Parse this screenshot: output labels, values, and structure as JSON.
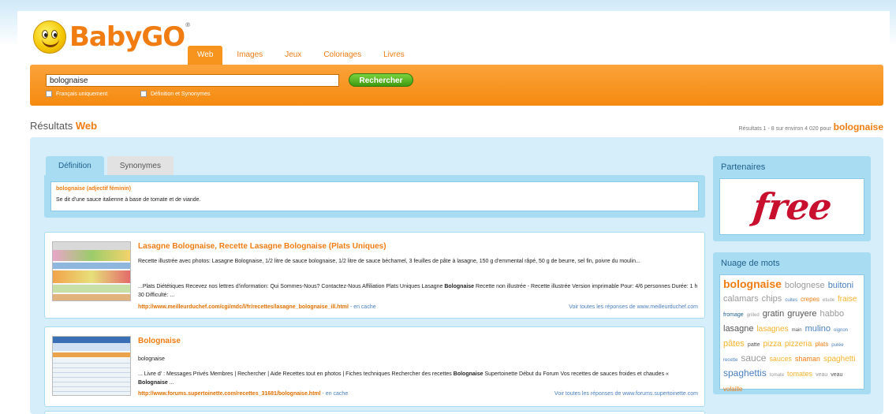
{
  "header": {
    "logo_text": "BabyGO",
    "logo_mark": "®",
    "tabs": [
      {
        "label": "Web",
        "active": true
      },
      {
        "label": "Images",
        "active": false
      },
      {
        "label": "Jeux",
        "active": false
      },
      {
        "label": "Coloriages",
        "active": false
      },
      {
        "label": "Livres",
        "active": false
      }
    ]
  },
  "search": {
    "query": "bolognaise",
    "button_label": "Rechercher",
    "option_french": "Français uniquement",
    "option_definition": "Définition et Synonymes"
  },
  "results_header": {
    "label": "Résultats",
    "label_emph": "Web",
    "count_text": "Résultats 1 - 8 sur environ 4 020 pour",
    "count_term": "bolognaise"
  },
  "definition": {
    "tab_definition": "Définition",
    "tab_synonyms": "Synonymes",
    "headword": "bolognaise (adjectif féminin)",
    "text": "Se dit d'une sauce italienne à base de tomate et de viande."
  },
  "results": [
    {
      "title": "Lasagne Bolognaise, Recette Lasagne Bolognaise (Plats Uniques)",
      "snippet1": "Recette illustrée avec photos: Lasagne Bolognaise, 1/2 litre de sauce bolognaise, 1/2 litre de sauce béchamel, 3 feuilles de pâte à lasagne, 150 g d'emmental râpé, 50 g de beurre, sel fin, poivre du moulin...",
      "snippet2_pre": "...Plats Diététiques Recevez nos lettres d'information: Qui Sommes-Nous? Contactez-Nous Affiliation Plats Uniques Lasagne ",
      "snippet2_bold": "Bolognaise",
      "snippet2_post": " Recette non illustrée - Recette illustrée Version imprimable Pour: 4/6 personnes Durée: 1 h 30 Difficulté: ...",
      "url": "http://www.meilleurduchef.com/cgi/mdc/l/fr/recettes/lasagne_bolognaise_ill.html",
      "cache": " - en cache",
      "more": "Voir toutes les réponses de www.meilleurduchef.com"
    },
    {
      "title": "Bolognaise",
      "snippet1": "bolognaise",
      "snippet2_pre": "... Livre d' : Messages Privés Membres | Rechercher | Aide Recettes tout en photos | Fiches techniques Rechercher des recettes ",
      "snippet2_bold": "Bolognaise",
      "snippet2_post": " Supertoinette Début du Forum Vos recettes de sauces froides et chaudes « ",
      "snippet2_bold2": "Bolognaise",
      "snippet2_end": " ...",
      "url": "http://www.forums.supertoinette.com/recettes_31681/bolognaise.html",
      "cache": " - en cache",
      "more": "Voir toutes les réponses de www.forums.supertoinette.com"
    }
  ],
  "sidebar": {
    "partners_title": "Partenaires",
    "partner_logo": "free",
    "cloud_title": "Nuage de mots",
    "cloud": [
      {
        "w": "bolognaise",
        "s": 14,
        "c": "#f07c12",
        "b": true
      },
      {
        "w": "bolognese",
        "s": 11,
        "c": "#999999"
      },
      {
        "w": "buitoni",
        "s": 11,
        "c": "#4a7fbf"
      },
      {
        "w": "calamars",
        "s": 11,
        "c": "#999999"
      },
      {
        "w": "chips",
        "s": 11,
        "c": "#999999"
      },
      {
        "w": "cuites",
        "s": 6,
        "c": "#4a7fbf"
      },
      {
        "w": "crepes",
        "s": 8,
        "c": "#f07c12"
      },
      {
        "w": "etude",
        "s": 6,
        "c": "#999999"
      },
      {
        "w": "fraise",
        "s": 10,
        "c": "#f7b32b"
      },
      {
        "w": "fromage",
        "s": 7,
        "c": "#1e5f8a"
      },
      {
        "w": "grilled",
        "s": 6,
        "c": "#999999"
      },
      {
        "w": "gratin",
        "s": 11,
        "c": "#555555"
      },
      {
        "w": "gruyere",
        "s": 11,
        "c": "#555555"
      },
      {
        "w": "habbo",
        "s": 11,
        "c": "#999999"
      },
      {
        "w": "lasagne",
        "s": 11,
        "c": "#555555"
      },
      {
        "w": "lasagnes",
        "s": 10,
        "c": "#f7b32b"
      },
      {
        "w": "main",
        "s": 6,
        "c": "#555555"
      },
      {
        "w": "mulino",
        "s": 11,
        "c": "#4a7fbf"
      },
      {
        "w": "oignon",
        "s": 6,
        "c": "#4a7fbf"
      },
      {
        "w": "pâtes",
        "s": 11,
        "c": "#f7b32b"
      },
      {
        "w": "patte",
        "s": 7,
        "c": "#555555"
      },
      {
        "w": "pizza",
        "s": 10,
        "c": "#f7b32b"
      },
      {
        "w": "pizzeria",
        "s": 10,
        "c": "#f7b32b"
      },
      {
        "w": "plats",
        "s": 8,
        "c": "#f07c12"
      },
      {
        "w": "purée",
        "s": 6,
        "c": "#4a7fbf"
      },
      {
        "w": "recette",
        "s": 6,
        "c": "#4a7fbf"
      },
      {
        "w": "sauce",
        "s": 12,
        "c": "#999999"
      },
      {
        "w": "sauces",
        "s": 9,
        "c": "#f7b32b"
      },
      {
        "w": "shaman",
        "s": 9,
        "c": "#f07c12"
      },
      {
        "w": "spaghetti",
        "s": 10,
        "c": "#f7b32b"
      },
      {
        "w": "spaghettis",
        "s": 12,
        "c": "#4a7fbf"
      },
      {
        "w": "tomate",
        "s": 6,
        "c": "#999999"
      },
      {
        "w": "tomates",
        "s": 9,
        "c": "#f7b32b"
      },
      {
        "w": "veau",
        "s": 7,
        "c": "#999999"
      },
      {
        "w": "veau",
        "s": 7,
        "c": "#555555"
      },
      {
        "w": "volaille",
        "s": 8,
        "c": "#f07c12"
      }
    ]
  },
  "colors": {
    "accent": "#f07c12",
    "panel": "#a8dcf3",
    "brand_free": "#c8102e",
    "button": "#4fae1e"
  }
}
